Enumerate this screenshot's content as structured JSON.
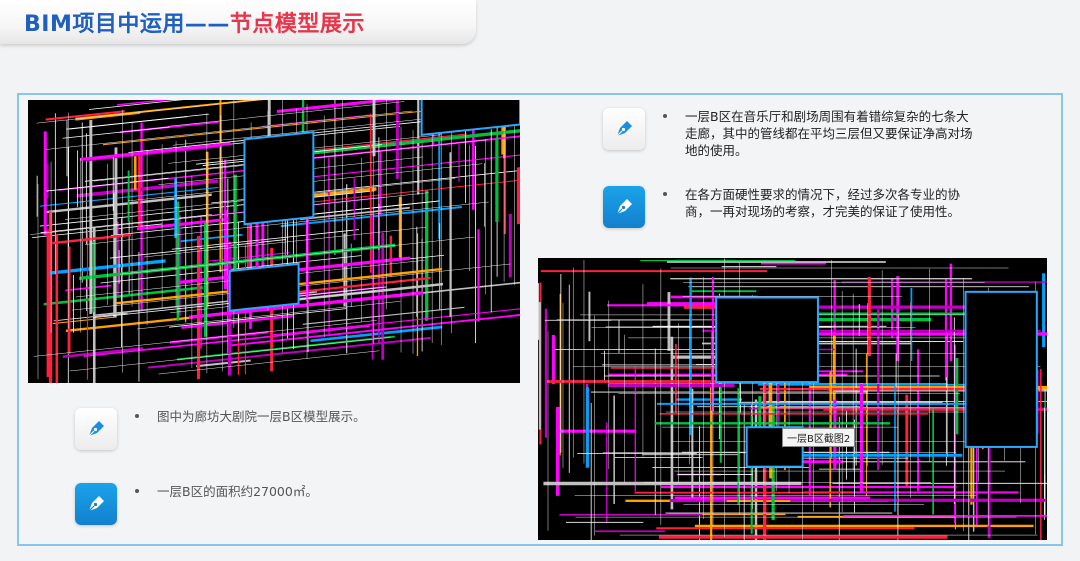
{
  "header": {
    "title_part1": "BIM项目中运用——",
    "title_part2": "节点模型展示"
  },
  "left_bullets": [
    {
      "icon": "pen-icon",
      "text": "图中为廊坊大剧院一层B区模型展示。"
    },
    {
      "icon": "pen-icon",
      "text": "一层B区的面积约27000㎡。"
    }
  ],
  "right_bullets": [
    {
      "icon": "pen-icon",
      "text": "一层B区在音乐厅和剧场周围有着错综复杂的七条大走廊，其中的管线都在平均三层但又要保证净高对场地的使用。"
    },
    {
      "icon": "pen-icon",
      "text": "在各方面硬性要求的情况下，经过多次各专业的协商，一再对现场的考察，才完美的保证了使用性。"
    }
  ],
  "screenshot_right": {
    "callout_label": "一层B区截图2"
  },
  "colors": {
    "title_blue": "#1f5fbf",
    "title_red": "#e8354c",
    "panel_border": "#86c6ec",
    "icon_blue": "#1280cf"
  }
}
